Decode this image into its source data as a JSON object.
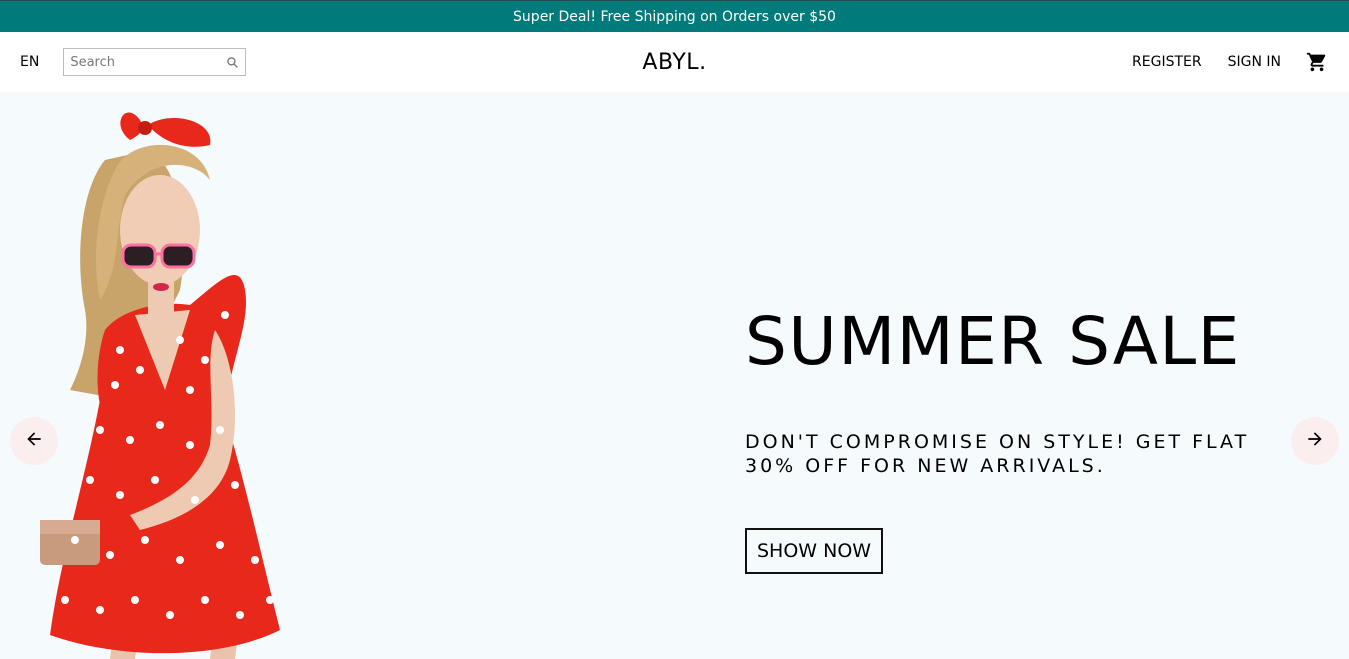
{
  "announcement": {
    "text": "Super Deal! Free Shipping on Orders over $50",
    "bg_color": "#007a7a"
  },
  "navbar": {
    "language": "EN",
    "search": {
      "placeholder": "Search",
      "value": ""
    },
    "logo": "ABYL.",
    "register": "REGISTER",
    "sign_in": "SIGN IN",
    "cart_icon": "shopping-cart-icon"
  },
  "slider": {
    "title": "SUMMER SALE",
    "description": "DON'T COMPROMISE ON STYLE! GET FLAT 30% OFF FOR NEW ARRIVALS.",
    "button": "SHOW NOW",
    "bg_color": "#f5fafd",
    "left_arrow_icon": "arrow-left-icon",
    "right_arrow_icon": "arrow-right-icon"
  }
}
